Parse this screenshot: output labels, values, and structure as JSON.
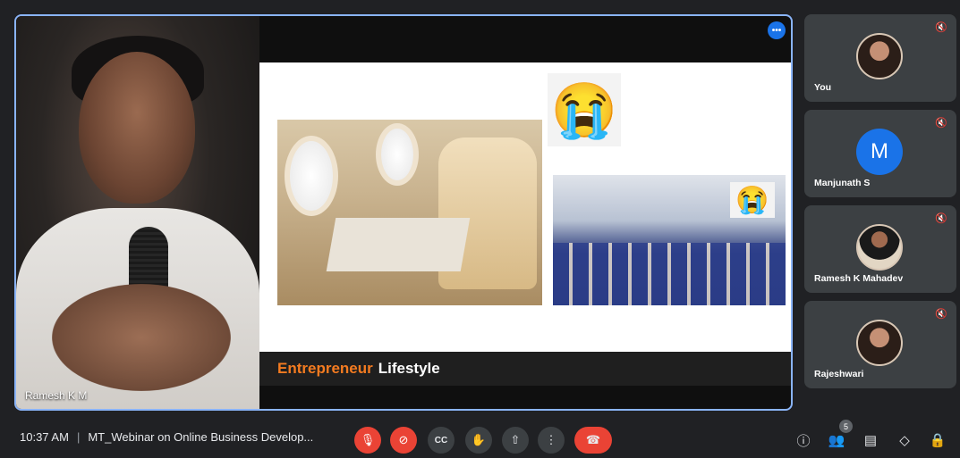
{
  "stage": {
    "presenter_name": "Ramesh K M",
    "slide": {
      "caption_accent": "Entrepreneur",
      "caption_rest": "Lifestyle",
      "big_emoji": "😭",
      "small_emoji": "😭"
    },
    "speaking_indicator": "•••"
  },
  "participants": [
    {
      "name": "You",
      "avatar": "photo"
    },
    {
      "name": "Manjunath S",
      "avatar": "letter",
      "letter": "M"
    },
    {
      "name": "Ramesh K Mahadev",
      "avatar": "photo"
    },
    {
      "name": "Rajeshwari",
      "avatar": "photo"
    }
  ],
  "bottombar": {
    "time": "10:37 AM",
    "separator": "|",
    "meeting_title": "MT_Webinar on Online Business Develop...",
    "people_count": "5"
  },
  "icons": {
    "mic_off": "🎙",
    "camera_off": "⊘",
    "captions": "CC",
    "raise_hand": "✋",
    "present": "⇧",
    "more": "⋮",
    "hangup": "☎",
    "info": "ⓘ",
    "people": "👥",
    "chat": "▤",
    "activities": "◇",
    "lock": "🔒",
    "muted": "🔇"
  },
  "colors": {
    "accent_blue": "#8ab4f8",
    "danger_red": "#ea4335",
    "caption_orange": "#f47b20",
    "avatar_blue": "#1a73e8"
  }
}
